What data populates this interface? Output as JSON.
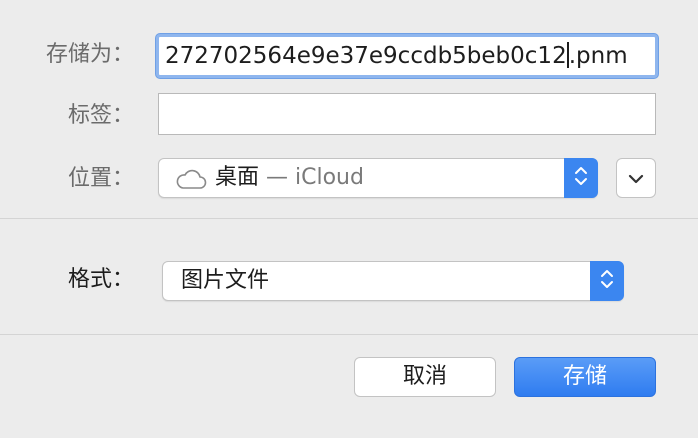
{
  "form": {
    "save_as_label": "存储为：",
    "filename_main": "272702564e9e37e9ccdb5beb0c12",
    "filename_ext": ".pnm",
    "tags_label": "标签：",
    "tags_value": "",
    "location_label": "位置：",
    "location_folder": "桌面",
    "location_service": "— iCloud"
  },
  "format": {
    "label": "格式：",
    "selected": "图片文件"
  },
  "buttons": {
    "cancel": "取消",
    "save": "存储"
  },
  "colors": {
    "accent": "#3b86f0",
    "focus_ring": "#8fb6ee"
  },
  "icons": {
    "location": "cloud-icon",
    "stepper": "up-down-chevron-icon",
    "expand": "chevron-down-icon"
  }
}
